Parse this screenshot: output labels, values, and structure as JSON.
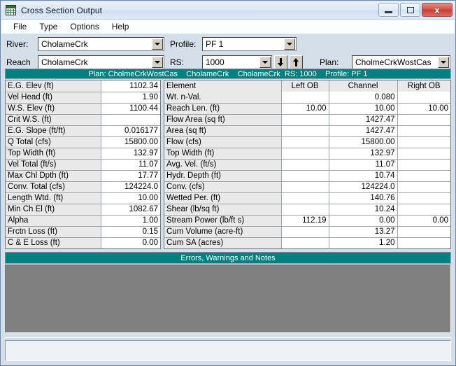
{
  "window": {
    "title": "Cross Section Output",
    "icon": "table-grid-icon",
    "minimize_label": "Minimize",
    "maximize_label": "Maximize",
    "close_label": "x",
    "accent_teal": "#00807f"
  },
  "menu": {
    "items": [
      {
        "label": "File"
      },
      {
        "label": "Type"
      },
      {
        "label": "Options"
      },
      {
        "label": "Help"
      }
    ]
  },
  "selectors": {
    "river_label": "River:",
    "river_value": "CholameCrk",
    "reach_label": "Reach",
    "reach_value": "CholameCrk",
    "profile_label": "Profile:",
    "profile_value": "PF 1",
    "rs_label": "RS:",
    "rs_value": "1000",
    "plan_label": "Plan:",
    "plan_value": "CholmeCrkWostCas",
    "prev_button": "down-arrow",
    "next_button": "up-arrow"
  },
  "plan_banner": "Plan: CholmeCrkWostCas    CholameCrk    CholameCrk  RS: 1000    Profile: PF 1",
  "left_table": {
    "rows": [
      {
        "label": "E.G. Elev (ft)",
        "value": "1102.34"
      },
      {
        "label": "Vel Head (ft)",
        "value": "1.90"
      },
      {
        "label": "W.S. Elev (ft)",
        "value": "1100.44"
      },
      {
        "label": "Crit W.S. (ft)",
        "value": ""
      },
      {
        "label": "E.G. Slope (ft/ft)",
        "value": "0.016177"
      },
      {
        "label": "Q Total (cfs)",
        "value": "15800.00"
      },
      {
        "label": "Top Width (ft)",
        "value": "132.97"
      },
      {
        "label": "Vel Total (ft/s)",
        "value": "11.07"
      },
      {
        "label": "Max Chl Dpth (ft)",
        "value": "17.77"
      },
      {
        "label": "Conv. Total (cfs)",
        "value": "124224.0"
      },
      {
        "label": "Length Wtd. (ft)",
        "value": "10.00"
      },
      {
        "label": "Min Ch El (ft)",
        "value": "1082.67"
      },
      {
        "label": "Alpha",
        "value": "1.00"
      },
      {
        "label": "Frctn Loss (ft)",
        "value": "0.15"
      },
      {
        "label": "C & E Loss (ft)",
        "value": "0.00"
      }
    ]
  },
  "right_table": {
    "headers": [
      "Element",
      "Left OB",
      "Channel",
      "Right OB"
    ],
    "rows": [
      {
        "label": "Wt. n-Val.",
        "left": "",
        "channel": "0.080",
        "right": ""
      },
      {
        "label": "Reach Len. (ft)",
        "left": "10.00",
        "channel": "10.00",
        "right": "10.00"
      },
      {
        "label": "Flow Area (sq ft)",
        "left": "",
        "channel": "1427.47",
        "right": ""
      },
      {
        "label": "Area (sq ft)",
        "left": "",
        "channel": "1427.47",
        "right": ""
      },
      {
        "label": "Flow (cfs)",
        "left": "",
        "channel": "15800.00",
        "right": ""
      },
      {
        "label": "Top Width (ft)",
        "left": "",
        "channel": "132.97",
        "right": ""
      },
      {
        "label": "Avg. Vel. (ft/s)",
        "left": "",
        "channel": "11.07",
        "right": ""
      },
      {
        "label": "Hydr. Depth (ft)",
        "left": "",
        "channel": "10.74",
        "right": ""
      },
      {
        "label": "Conv. (cfs)",
        "left": "",
        "channel": "124224.0",
        "right": ""
      },
      {
        "label": "Wetted Per. (ft)",
        "left": "",
        "channel": "140.76",
        "right": ""
      },
      {
        "label": "Shear (lb/sq ft)",
        "left": "",
        "channel": "10.24",
        "right": ""
      },
      {
        "label": "Stream Power (lb/ft s)",
        "left": "112.19",
        "channel": "0.00",
        "right": "0.00"
      },
      {
        "label": "Cum Volume (acre-ft)",
        "left": "",
        "channel": "13.27",
        "right": ""
      },
      {
        "label": "Cum SA (acres)",
        "left": "",
        "channel": "1.20",
        "right": ""
      }
    ]
  },
  "errors_panel": {
    "title": "Errors, Warnings and Notes",
    "content": ""
  },
  "status_bar": {
    "text": ""
  }
}
